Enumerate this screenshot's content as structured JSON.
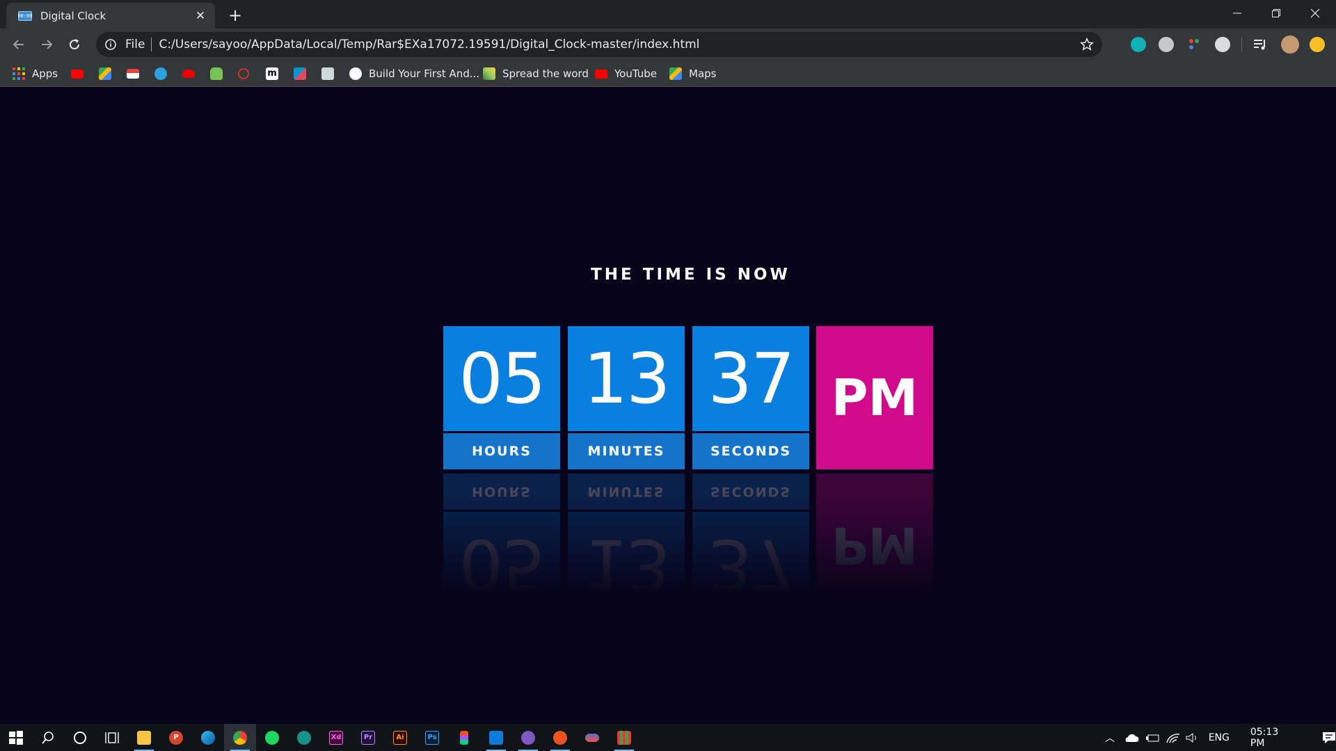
{
  "browser": {
    "tab": {
      "title": "Digital Clock",
      "favicon_text": "00:00"
    },
    "address": {
      "scheme": "File",
      "url": "C:/Users/sayoo/AppData/Local/Temp/Rar$EXa17072.19591/Digital_Clock-master/index.html"
    },
    "bookmarks": [
      {
        "label": "Apps",
        "icon": "apps-grid-icon"
      },
      {
        "label": "",
        "icon": "youtube-icon"
      },
      {
        "label": "",
        "icon": "maps-icon"
      },
      {
        "label": "",
        "icon": "gmail-icon"
      },
      {
        "label": "",
        "icon": "telegram-icon"
      },
      {
        "label": "",
        "icon": "redhat-icon"
      },
      {
        "label": "",
        "icon": "android-icon"
      },
      {
        "label": "",
        "icon": "ruby-icon"
      },
      {
        "label": "",
        "icon": "medium-icon"
      },
      {
        "label": "",
        "icon": "kotlin-icon"
      },
      {
        "label": "",
        "icon": "bookmark-site-icon"
      },
      {
        "label": "Build Your First And...",
        "icon": "globe-icon"
      },
      {
        "label": "Spread the word",
        "icon": "spread-icon"
      },
      {
        "label": "YouTube",
        "icon": "youtube-icon"
      },
      {
        "label": "Maps",
        "icon": "maps-icon"
      }
    ]
  },
  "page": {
    "heading": "THE TIME IS NOW",
    "clock": {
      "hours": "05",
      "hours_label": "HOURS",
      "minutes": "13",
      "minutes_label": "MINUTES",
      "seconds": "37",
      "seconds_label": "SECONDS",
      "ampm": "PM"
    }
  },
  "taskbar": {
    "tray": {
      "language": "ENG",
      "time": "05:13 PM"
    },
    "apps": [
      "windows-start",
      "search",
      "cortana",
      "task-view",
      "file-explorer",
      "wps",
      "edge",
      "chrome",
      "spotify",
      "gitkraken",
      "adobe-xd",
      "premiere-pro",
      "illustrator",
      "photoshop",
      "figma",
      "vscode",
      "app-circle",
      "ubuntu",
      "app-pill",
      "app-grid"
    ]
  },
  "colors": {
    "page_bg": "#07031b",
    "digit_bg": "#0a7fe0",
    "label_bg": "#1574c9",
    "ampm_bg": "#d10a8c"
  }
}
